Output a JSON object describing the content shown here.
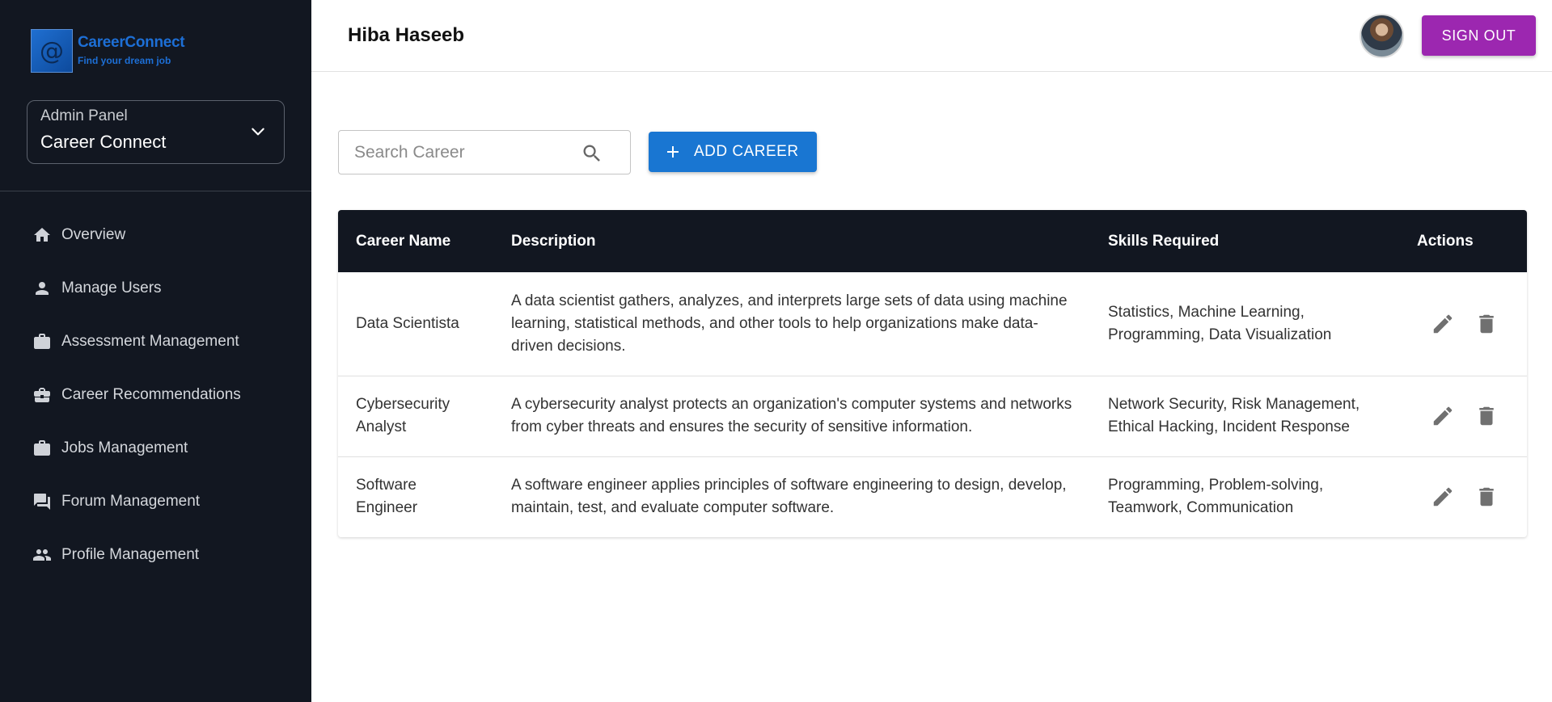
{
  "brand": {
    "mark": "@",
    "title": "CareerConnect",
    "tagline": "Find your dream job",
    "color": "#1d6fd6"
  },
  "panel": {
    "label": "Admin Panel",
    "value": "Career Connect"
  },
  "sidebar": {
    "items": [
      {
        "label": "Overview",
        "icon": "home-icon"
      },
      {
        "label": "Manage Users",
        "icon": "person-icon"
      },
      {
        "label": "Assessment Management",
        "icon": "briefcase-icon"
      },
      {
        "label": "Career Recommendations",
        "icon": "business-center-icon"
      },
      {
        "label": "Jobs Management",
        "icon": "briefcase-icon"
      },
      {
        "label": "Forum Management",
        "icon": "forum-icon"
      },
      {
        "label": "Profile Management",
        "icon": "people-icon"
      }
    ]
  },
  "header": {
    "user_name": "Hiba Haseeb",
    "signout_label": "SIGN OUT"
  },
  "toolbar": {
    "search_placeholder": "Search Career",
    "add_label": "ADD CAREER"
  },
  "table": {
    "headers": [
      "Career Name",
      "Description",
      "Skills Required",
      "Actions"
    ],
    "rows": [
      {
        "name": "Data Scientista",
        "description": "A data scientist gathers, analyzes, and interprets large sets of data using machine learning, statistical methods, and other tools to help organizations make data-driven decisions.",
        "skills": "Statistics, Machine Learning, Programming, Data Visualization"
      },
      {
        "name": "Cybersecurity Analyst",
        "description": "A cybersecurity analyst protects an organization's computer systems and networks from cyber threats and ensures the security of sensitive information.",
        "skills": "Network Security, Risk Management, Ethical Hacking, Incident Response"
      },
      {
        "name": "Software Engineer",
        "description": "A software engineer applies principles of software engineering to design, develop, maintain, test, and evaluate computer software.",
        "skills": "Programming, Problem-solving, Teamwork, Communication"
      }
    ]
  },
  "colors": {
    "sidebar_bg": "#121721",
    "accent_blue": "#1976d2",
    "signout_purple": "#9c27b0"
  }
}
